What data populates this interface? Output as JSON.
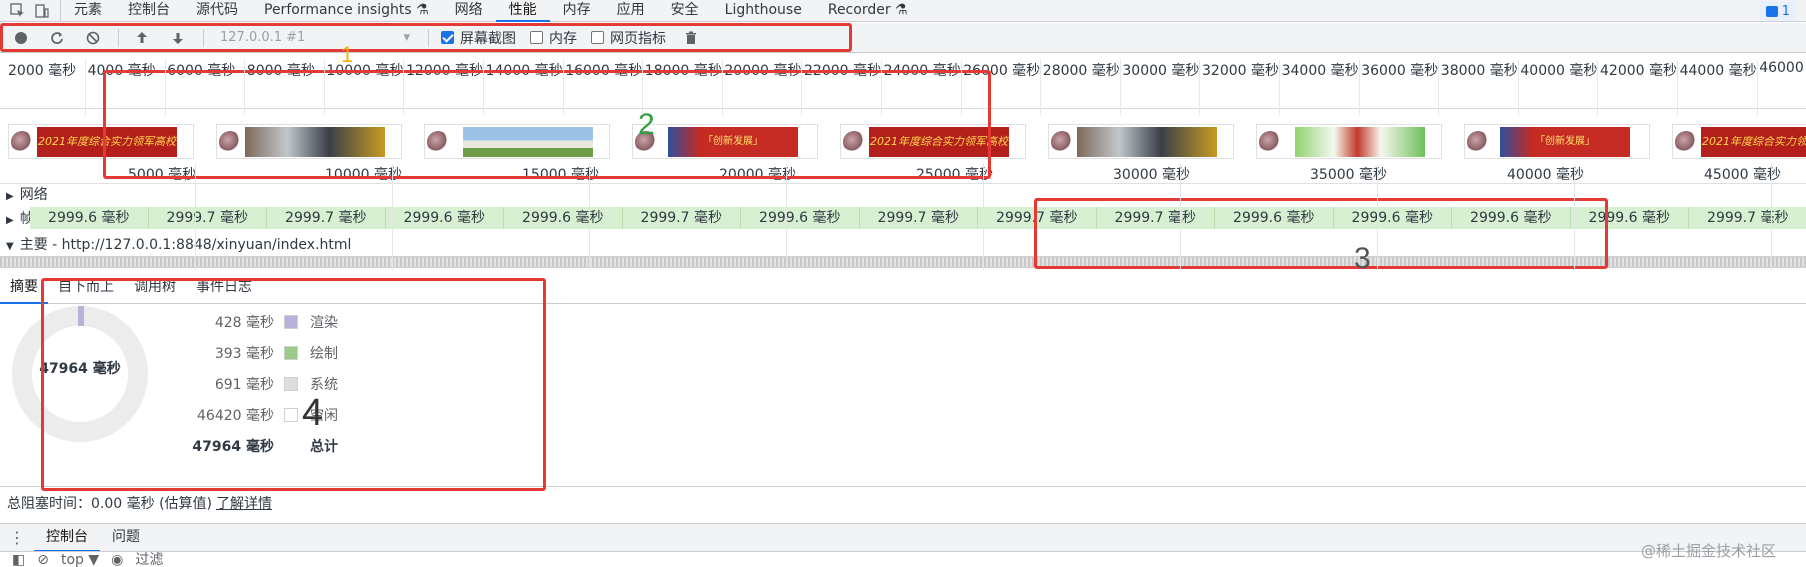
{
  "tabs": [
    "元素",
    "控制台",
    "源代码",
    "Performance insights ⚗",
    "网络",
    "性能",
    "内存",
    "应用",
    "安全",
    "Lighthouse",
    "Recorder ⚗"
  ],
  "active_tab": "性能",
  "badge_count": "1",
  "toolbar": {
    "target": "127.0.0.1 #1",
    "screenshots_label": "屏幕截图",
    "memory_label": "内存",
    "webvitals_label": "网页指标"
  },
  "overview_ticks": [
    "2000 毫秒",
    "4000 毫秒",
    "6000 毫秒",
    "8000 毫秒",
    "10000 毫秒",
    "12000 毫秒",
    "14000 毫秒",
    "16000 毫秒",
    "18000 毫秒",
    "20000 毫秒",
    "22000 毫秒",
    "24000 毫秒",
    "26000 毫秒",
    "28000 毫秒",
    "30000 毫秒",
    "32000 毫秒",
    "34000 毫秒",
    "36000 毫秒",
    "38000 毫秒",
    "40000 毫秒",
    "42000 毫秒",
    "44000 毫秒",
    "46000"
  ],
  "film_captions": {
    "red": "2021年度综合实力领军高校",
    "flag": "「创新发展」"
  },
  "main_ticks": [
    "5000 毫秒",
    "10000 毫秒",
    "15000 毫秒",
    "20000 毫秒",
    "25000 毫秒",
    "30000 毫秒",
    "35000 毫秒",
    "40000 毫秒",
    "45000 毫秒"
  ],
  "tracks": {
    "network": "网络",
    "frames": "帧",
    "main": "主要 - http://127.0.0.1:8848/xinyuan/index.html"
  },
  "frame_values": [
    "2999.6 毫秒",
    "2999.7 毫秒",
    "2999.7 毫秒",
    "2999.6 毫秒",
    "2999.6 毫秒",
    "2999.7 毫秒",
    "2999.6 毫秒",
    "2999.7 毫秒",
    "2999.7 毫秒",
    "2999.7 毫秒",
    "2999.6 毫秒",
    "2999.6 毫秒",
    "2999.6 毫秒",
    "2999.6 毫秒",
    "2999.7 毫秒"
  ],
  "bottom_tabs": [
    "摘要",
    "自下而上",
    "调用树",
    "事件日志"
  ],
  "summary": {
    "total_center": "47964 毫秒",
    "rows": [
      {
        "value": "428 毫秒",
        "name": "渲染",
        "color": "#b7b2d9"
      },
      {
        "value": "393 毫秒",
        "name": "绘制",
        "color": "#9acb87"
      },
      {
        "value": "691 毫秒",
        "name": "系统",
        "color": "#dedede"
      },
      {
        "value": "46420 毫秒",
        "name": "空闲",
        "color": "#ffffff"
      }
    ],
    "total_value": "47964 毫秒",
    "total_name": "总计"
  },
  "blocking": {
    "text": "总阻塞时间：0.00 毫秒 (估算值)",
    "link": "了解详情"
  },
  "drawer_tabs": [
    "控制台",
    "问题"
  ],
  "console": {
    "context": "top ▼",
    "filter": "过滤"
  },
  "annotations": [
    "1",
    "2",
    "3",
    "4"
  ],
  "annotation_colors": {
    "1": "#f5b400",
    "2": "#2e9e3e",
    "3": "#555555",
    "4": "#333333",
    "box": "#e53935"
  },
  "watermark": "@稀土掘金技术社区"
}
